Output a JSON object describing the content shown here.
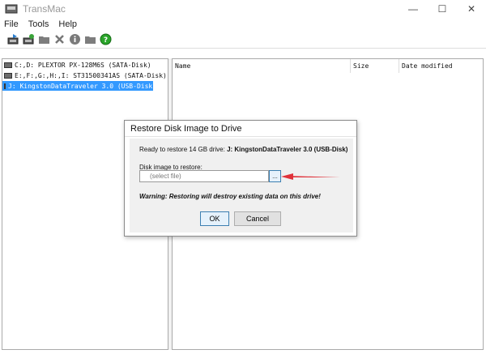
{
  "window": {
    "title": "TransMac",
    "controls": [
      "—",
      "☐",
      "✕"
    ]
  },
  "menu": [
    "File",
    "Tools",
    "Help"
  ],
  "toolbar": {
    "icons": [
      "save-image-icon",
      "restore-image-icon",
      "open-folder-icon",
      "delete-icon",
      "info-icon",
      "folder-icon",
      "help-icon"
    ]
  },
  "drives": [
    {
      "label": "C:,D: PLEXTOR PX-128M6S (SATA-Disk)",
      "selected": false
    },
    {
      "label": "E:,F:,G:,H:,I: ST31500341AS (SATA-Disk)",
      "selected": false
    },
    {
      "label": "J: KingstonDataTraveler 3.0 (USB-Disk)",
      "selected": true
    }
  ],
  "columns": {
    "name": "Name",
    "size": "Size",
    "date": "Date modified"
  },
  "dialog": {
    "title": "Restore Disk Image to Drive",
    "ready_prefix": "Ready to restore 14 GB drive: ",
    "ready_drive": "J: KingstonDataTraveler 3.0 (USB-Disk)",
    "disk_label": "Disk image to restore:",
    "file_placeholder": "(select file)",
    "browse_label": "...",
    "warning": "Warning: Restoring will destroy existing data on this drive!",
    "ok_label": "OK",
    "cancel_label": "Cancel"
  },
  "colors": {
    "selection": "#3399ff",
    "arrow": "#e0323a",
    "help_icon": "#2aa52a"
  }
}
